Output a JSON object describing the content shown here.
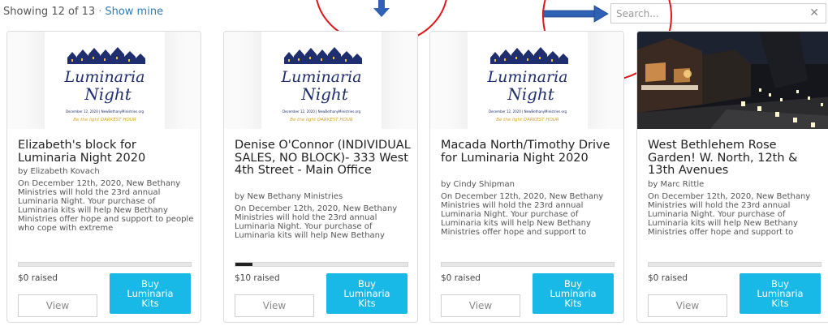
{
  "header": {
    "showing_text": "Showing 12 of 13",
    "separator": "·",
    "show_mine_label": "Show mine"
  },
  "search": {
    "placeholder": "Search...",
    "clear_symbol": "✕"
  },
  "logo": {
    "line1": "Luminaria",
    "line2": "Night",
    "date_line": "December 12, 2020 | NewBethanyMinistries.org",
    "tagline": "Be the light DARKEST HOUR"
  },
  "cards": [
    {
      "title": "Elizabeth's block for Luminaria Night 2020",
      "author": "by Elizabeth Kovach",
      "description": "On December 12th, 2020, New Bethany Ministries will hold the 23rd annual Luminaria Night. Your purchase of Luminaria kits will help New Bethany Ministries offer hope and support to people who cope with extreme",
      "raised": "$0 raised",
      "progress_fraction": 0,
      "view_label": "View",
      "buy_label": "Buy Luminaria Kits"
    },
    {
      "title": "Denise O'Connor (INDIVIDUAL SALES, NO BLOCK)- 333 West 4th Street - Main Office",
      "author": "by New Bethany Ministries",
      "description": "On December 12th, 2020, New Bethany Ministries will hold the 23rd annual Luminaria Night. Your purchase of Luminaria kits will help New Bethany",
      "raised": "$10 raised",
      "progress_fraction": 0.1,
      "view_label": "View",
      "buy_label": "Buy Luminaria Kits"
    },
    {
      "title": "Macada North/Timothy Drive for Luminaria Night 2020",
      "author": "by Cindy Shipman",
      "description": "On December 12th, 2020, New Bethany Ministries will hold the 23rd annual Luminaria Night. Your purchase of Luminaria kits will help New Bethany Ministries offer hope and support to",
      "raised": "$0 raised",
      "progress_fraction": 0,
      "view_label": "View",
      "buy_label": "Buy Luminaria Kits"
    },
    {
      "title": "West Bethlehem Rose Garden! W. North, 12th & 13th Avenues",
      "author": "by Marc Rittle",
      "description": "On December 12th, 2020, New Bethany Ministries will hold the 23rd annual Luminaria Night. Your purchase of Luminaria kits will help New Bethany Ministries offer hope and support to",
      "raised": "$0 raised",
      "progress_fraction": 0,
      "view_label": "View",
      "buy_label": "Buy Luminaria Kits"
    }
  ],
  "colors": {
    "buy_button": "#18b9e6",
    "link": "#2d7db3",
    "annotation_red": "#e0161b",
    "annotation_arrow": "#2f62b4"
  }
}
